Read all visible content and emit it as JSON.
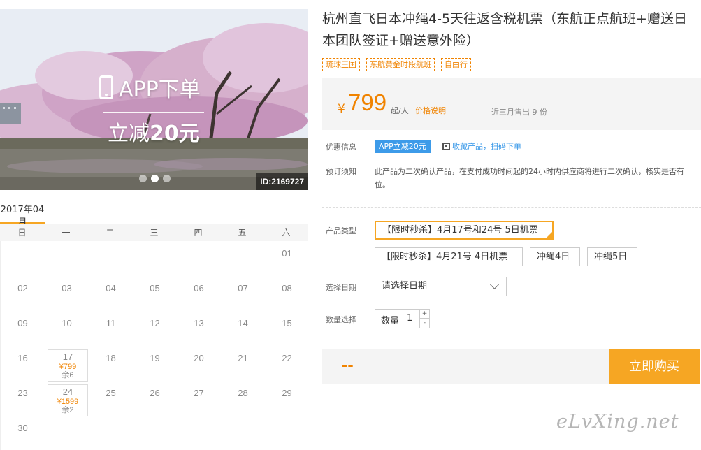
{
  "banner": {
    "promo_line1": "APP下单",
    "promo_line2_prefix": "立减",
    "promo_line2_amount": "20元",
    "id_badge": "ID:2169727",
    "dots": 3,
    "active_dot": 1
  },
  "calendar": {
    "month": "2017年04月",
    "weekdays": [
      "日",
      "一",
      "二",
      "三",
      "四",
      "五",
      "六"
    ],
    "weeks": [
      [
        "",
        "",
        "",
        "",
        "",
        "",
        "01"
      ],
      [
        "02",
        "03",
        "04",
        "05",
        "06",
        "07",
        "08"
      ],
      [
        "09",
        "10",
        "11",
        "12",
        "13",
        "14",
        "15"
      ],
      [
        "16",
        "17",
        "18",
        "19",
        "20",
        "21",
        "22"
      ],
      [
        "23",
        "24",
        "25",
        "26",
        "27",
        "28",
        "29"
      ],
      [
        "30",
        "",
        "",
        "",
        "",
        "",
        ""
      ]
    ],
    "priced_days": {
      "17": {
        "price": "¥799",
        "stock": "余6"
      },
      "24": {
        "price": "¥1599",
        "stock": "余2"
      }
    }
  },
  "product": {
    "title": "杭州直飞日本冲绳4-5天往返含税机票（东航正点航班+赠送日本团队签证+赠送意外险）",
    "tags": [
      "琉球王国",
      "东航黄金时段航班",
      "自由行"
    ]
  },
  "price": {
    "currency": "¥",
    "amount": "799",
    "unit": "起/人",
    "explain_link": "价格说明",
    "sold": "近三月售出 9 份"
  },
  "promo": {
    "label": "优惠信息",
    "badge": "APP立减20元",
    "fav_link": "收藏产品，扫码下单"
  },
  "notice": {
    "label": "预订须知",
    "text": "此产品为二次确认产品，在支付成功时间起的24小时内供应商将进行二次确认，核实是否有位。"
  },
  "options": {
    "label": "产品类型",
    "items": [
      "【限时秒杀】4月17号和24号 5日机票",
      "【限时秒杀】4月21号 4日机票",
      "冲绳4日",
      "冲绳5日"
    ],
    "selected_index": 0
  },
  "date": {
    "label": "选择日期",
    "placeholder": "请选择日期"
  },
  "quantity": {
    "label": "数量选择",
    "field_label": "数量",
    "value": "1",
    "plus": "+",
    "minus": "-"
  },
  "buy": {
    "total": "--",
    "button_label": "立即购买"
  },
  "watermark": "eLvXing.net",
  "colors": {
    "accent": "#f08300",
    "button": "#f6a623",
    "link_blue": "#3d9be9"
  }
}
